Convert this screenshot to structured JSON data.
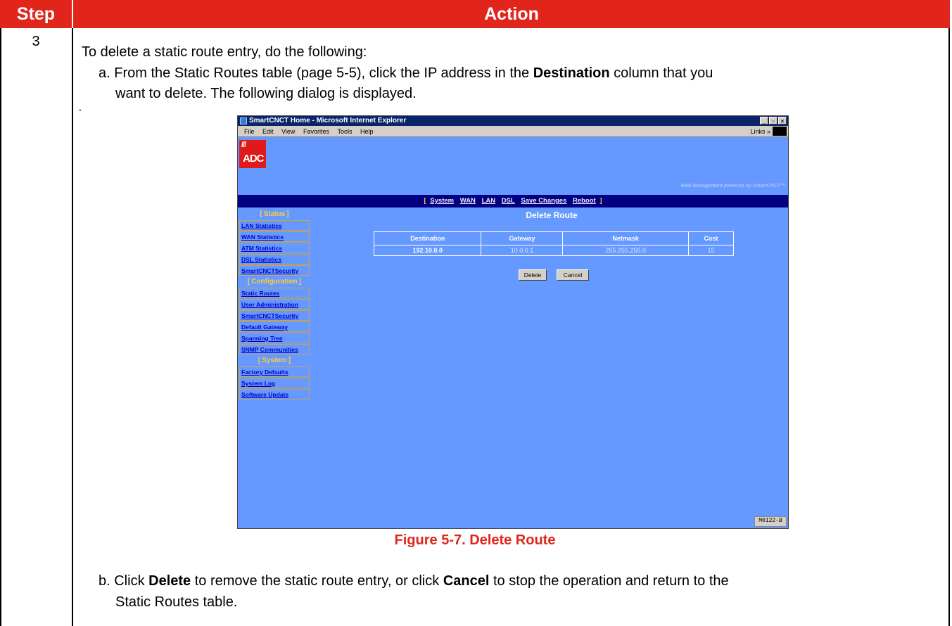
{
  "header": {
    "step_label": "Step",
    "action_label": "Action"
  },
  "step_number": "3",
  "intro": "To delete a static route entry, do the following:",
  "step_a": {
    "prefix": "a. From the Static Routes table (page 5-5), click the IP address in the ",
    "bold": "Destination",
    "suffix": " column that you",
    "line2": "want to delete. The following dialog is displayed."
  },
  "small_mark": "°",
  "browser": {
    "title": "SmartCNCT Home - Microsoft Internet Explorer",
    "window_buttons": [
      "_",
      "▫",
      "×"
    ],
    "menu": [
      "File",
      "Edit",
      "View",
      "Favorites",
      "Tools",
      "Help"
    ],
    "links_label": "Links »",
    "logo_slashes": "///",
    "logo_text": "ADC",
    "powered_by": "Web Management powered by SmartCNCT™",
    "nav": [
      "System",
      "WAN",
      "LAN",
      "DSL",
      "Save Changes",
      "Reboot"
    ],
    "nav_open": "[",
    "nav_close": "]",
    "heading": "Delete Route",
    "sidebar": {
      "status_title": "Status",
      "status_items": [
        "LAN Statistics",
        "WAN Statistics",
        "ATM Statistics",
        "DSL Statistics",
        "SmartCNCTSecurity"
      ],
      "config_title": "Configuration",
      "config_items": [
        "Static Routes",
        "User Administration",
        "SmartCNCTSecurity",
        "Default Gateway",
        "Spanning Tree",
        "SNMP Communities"
      ],
      "system_title": "System",
      "system_items": [
        "Factory Defaults",
        "System Log",
        "Software Update"
      ]
    },
    "table": {
      "headers": [
        "Destination",
        "Gateway",
        "Netmask",
        "Cost"
      ],
      "row": [
        "192.10.0.0",
        "10.0.0.1",
        "255.255.255.0",
        "15"
      ]
    },
    "delete_button": "Delete",
    "cancel_button": "Cancel",
    "figure_id": "M0122-B"
  },
  "caption": "Figure 5-7. Delete Route",
  "step_b": {
    "p1": "b. Click ",
    "b1": "Delete",
    "p2": " to remove the static route entry, or click ",
    "b2": "Cancel",
    "p3": " to stop the operation and return to the",
    "line2": "Static Routes table."
  },
  "colors": {
    "header_red": "#e1251b",
    "page_blue": "#6699ff",
    "nav_navy": "#000080",
    "caption_red": "#e1251b"
  }
}
